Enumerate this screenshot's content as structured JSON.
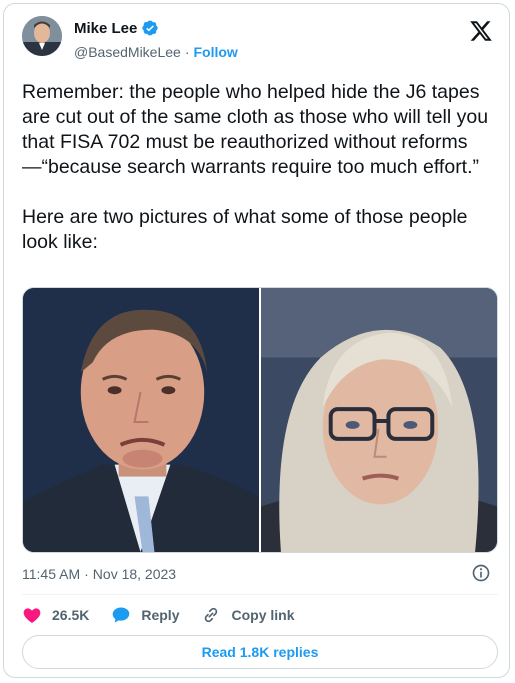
{
  "author": {
    "name": "Mike Lee",
    "handle": "@BasedMikeLee",
    "separator": "·",
    "follow_label": "Follow"
  },
  "tweet": {
    "text": "Remember: the people who helped hide the J6 tapes are cut out of the same cloth as those who will tell you that FISA 702 must be reauthorized without reforms—“because search warrants require too much effort.”\n\nHere are two pictures of what some of those people look like:"
  },
  "meta": {
    "time": "11:45 AM",
    "separator": "·",
    "date": "Nov 18, 2023"
  },
  "actions": {
    "likes": "26.5K",
    "reply_label": "Reply",
    "copy_link_label": "Copy link"
  },
  "read_replies_label": "Read 1.8K replies",
  "colors": {
    "accent": "#1d9bf0",
    "like": "#f91880",
    "verified": "#1d9bf0",
    "muted_text": "#536471",
    "border": "#cfd9de"
  },
  "icons": [
    "verified-badge-icon",
    "x-logo-icon",
    "info-icon",
    "heart-icon",
    "reply-bubble-icon",
    "link-icon"
  ]
}
